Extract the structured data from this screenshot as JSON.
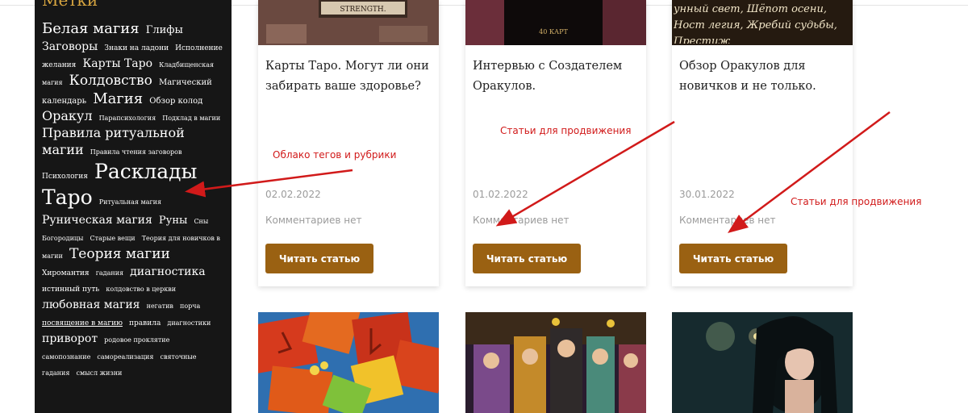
{
  "sidebar": {
    "title": "Метки",
    "tags": [
      {
        "label": "Белая магия",
        "size": 18
      },
      {
        "label": "Глифы",
        "size": 13
      },
      {
        "label": "Заговоры",
        "size": 14
      },
      {
        "label": "Знаки на ладони",
        "size": 9
      },
      {
        "label": "Исполнение желания",
        "size": 9
      },
      {
        "label": "Карты Таро",
        "size": 14
      },
      {
        "label": "Кладбищенская магия",
        "size": 8
      },
      {
        "label": "Колдовство",
        "size": 17
      },
      {
        "label": "Магический календарь",
        "size": 10
      },
      {
        "label": "Магия",
        "size": 18
      },
      {
        "label": "Обзор колод",
        "size": 10
      },
      {
        "label": "Оракул",
        "size": 16
      },
      {
        "label": "Парапсихология",
        "size": 8
      },
      {
        "label": "Подклад в магии",
        "size": 8
      },
      {
        "label": "Правила ритуальной магии",
        "size": 16
      },
      {
        "label": "Правила чтения заговоров",
        "size": 8
      },
      {
        "label": "Психология",
        "size": 9
      },
      {
        "label": "Расклады Таро",
        "size": 26
      },
      {
        "label": "Ритуальная магия",
        "size": 8
      },
      {
        "label": "Руническая магия",
        "size": 14
      },
      {
        "label": "Руны",
        "size": 13
      },
      {
        "label": "Сны Богородицы",
        "size": 8
      },
      {
        "label": "Старые вещи",
        "size": 8
      },
      {
        "label": "Теория для новичков в магии",
        "size": 8
      },
      {
        "label": "Теория магии",
        "size": 17
      },
      {
        "label": "Хиромантия",
        "size": 9
      },
      {
        "label": "гадания",
        "size": 8
      },
      {
        "label": "диагностика",
        "size": 14
      },
      {
        "label": "истинный путь",
        "size": 9
      },
      {
        "label": "колдовство в церкви",
        "size": 8
      },
      {
        "label": "любовная магия",
        "size": 14
      },
      {
        "label": "негатив",
        "size": 8
      },
      {
        "label": "порча",
        "size": 8
      },
      {
        "label": "посвящение в магию",
        "size": 9,
        "underline": true
      },
      {
        "label": "правила",
        "size": 9
      },
      {
        "label": "диагностики",
        "size": 8
      },
      {
        "label": "приворот",
        "size": 14
      },
      {
        "label": "родовое проклятие",
        "size": 8
      },
      {
        "label": "самопознание",
        "size": 8
      },
      {
        "label": "самореализация",
        "size": 8
      },
      {
        "label": "святочные гадания",
        "size": 8
      },
      {
        "label": "смысл жизни",
        "size": 8
      }
    ]
  },
  "cards": [
    {
      "title": "Карты Таро. Могут ли они забирать ваше здоровье?",
      "date": "02.02.2022",
      "comments": "Комментариев нет",
      "button": "Читать статью",
      "image_text": "STRENGTH."
    },
    {
      "title": "Интервью с Создателем Оракулов.",
      "date": "01.02.2022",
      "comments": "Комментариев нет",
      "button": "Читать статью",
      "image_text": "40 КАРТ"
    },
    {
      "title": "Обзор Оракулов для новичков и не только.",
      "date": "30.01.2022",
      "comments": "Комментариев нет",
      "button": "Читать статью",
      "image_text": "унный свет, Шёпот осени, Ност легия, Жребий судьбы, Престиж"
    }
  ],
  "annotations": {
    "tags_cloud": "Облако тегов и рубрики",
    "promo_1": "Статьи для продвижения",
    "promo_2": "Статьи для продвижения"
  },
  "colors": {
    "sidebar_bg": "#161616",
    "button_bg": "#9a6112",
    "annotation": "#d11a1a",
    "title_accent": "#d9a640"
  }
}
